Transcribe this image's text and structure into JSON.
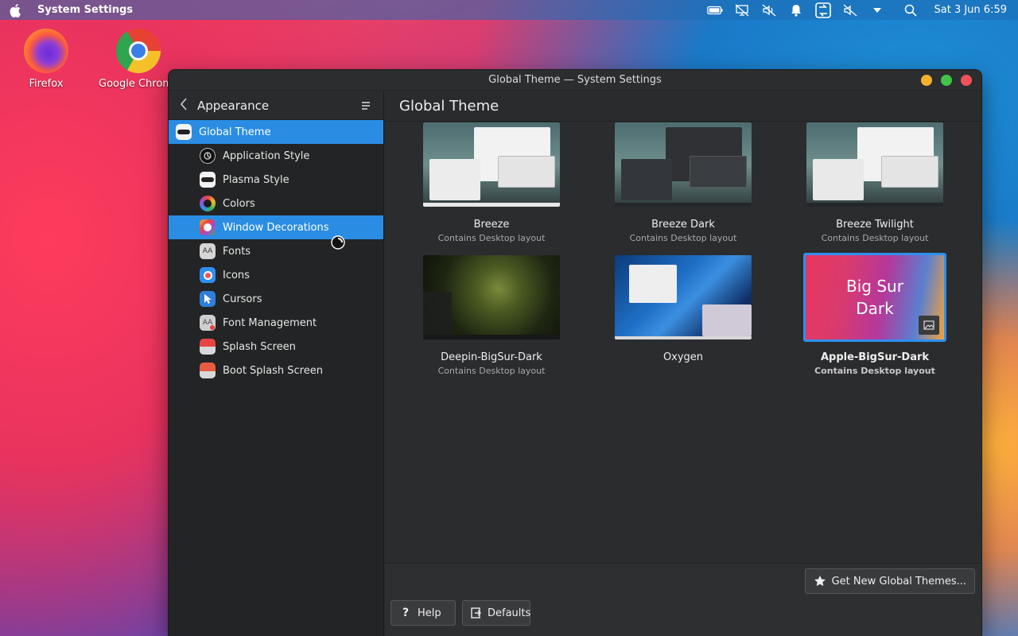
{
  "topbar": {
    "app_name": "System Settings",
    "clock": "Sat 3 Jun 6:59"
  },
  "desktop": {
    "icons": [
      {
        "label": "Firefox"
      },
      {
        "label": "Google Chrome"
      }
    ]
  },
  "window": {
    "title": "Global Theme — System Settings"
  },
  "sidebar": {
    "header": "Appearance",
    "items": [
      {
        "label": "Global Theme",
        "icon": "global-theme-icon"
      },
      {
        "label": "Application Style",
        "icon": "application-style-icon"
      },
      {
        "label": "Plasma Style",
        "icon": "plasma-style-icon"
      },
      {
        "label": "Colors",
        "icon": "colors-icon"
      },
      {
        "label": "Window Decorations",
        "icon": "window-decorations-icon"
      },
      {
        "label": "Fonts",
        "icon": "fonts-icon"
      },
      {
        "label": "Icons",
        "icon": "icons-icon"
      },
      {
        "label": "Cursors",
        "icon": "cursors-icon"
      },
      {
        "label": "Font Management",
        "icon": "font-management-icon"
      },
      {
        "label": "Splash Screen",
        "icon": "splash-screen-icon"
      },
      {
        "label": "Boot Splash Screen",
        "icon": "boot-splash-screen-icon"
      }
    ]
  },
  "main": {
    "title": "Global Theme",
    "themes": [
      {
        "name": "Breeze",
        "subtitle": "Contains Desktop layout"
      },
      {
        "name": "Breeze Dark",
        "subtitle": "Contains Desktop layout"
      },
      {
        "name": "Breeze Twilight",
        "subtitle": "Contains Desktop layout"
      },
      {
        "name": "Deepin-BigSur-Dark",
        "subtitle": "Contains Desktop layout"
      },
      {
        "name": "Oxygen",
        "subtitle": ""
      },
      {
        "name": "Apple-BigSur-Dark",
        "subtitle": "Contains Desktop layout",
        "preview_text_1": "Big Sur",
        "preview_text_2": "Dark"
      }
    ],
    "get_new_label": "Get New Global Themes...",
    "help_label": "Help",
    "defaults_label": "Defaults"
  },
  "colors": {
    "accent": "#2a8de3",
    "selection_border": "#2e8ff0"
  }
}
